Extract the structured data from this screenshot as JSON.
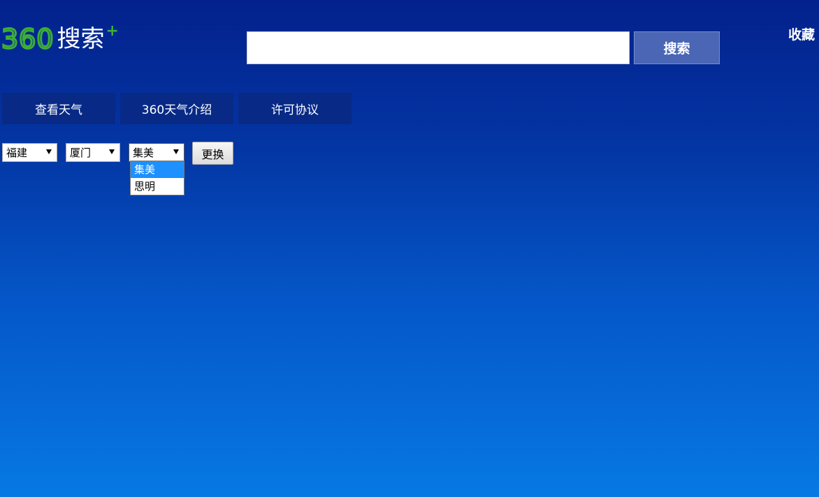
{
  "header": {
    "logo_number": "360",
    "logo_text": "搜索",
    "logo_plus": "+",
    "search": {
      "value": "",
      "placeholder": "",
      "button_label": "搜索"
    },
    "favorite_label": "收藏"
  },
  "nav": {
    "tabs": [
      {
        "label": "查看天气"
      },
      {
        "label": "360天气介绍"
      },
      {
        "label": "许可协议"
      }
    ]
  },
  "location": {
    "province": {
      "selected": "福建"
    },
    "city": {
      "selected": "厦门"
    },
    "district": {
      "selected": "集美",
      "options": [
        "集美",
        "思明"
      ],
      "open": true
    },
    "change_button_label": "更换"
  },
  "colors": {
    "background_top": "#03218c",
    "background_bottom": "#0679e3",
    "logo_green": "#3dae37",
    "search_button": "#4a66b5",
    "nav_tab": "#082a86",
    "dropdown_highlight": "#1e90ff"
  },
  "icons": {
    "select_arrow": "triangle-down"
  }
}
